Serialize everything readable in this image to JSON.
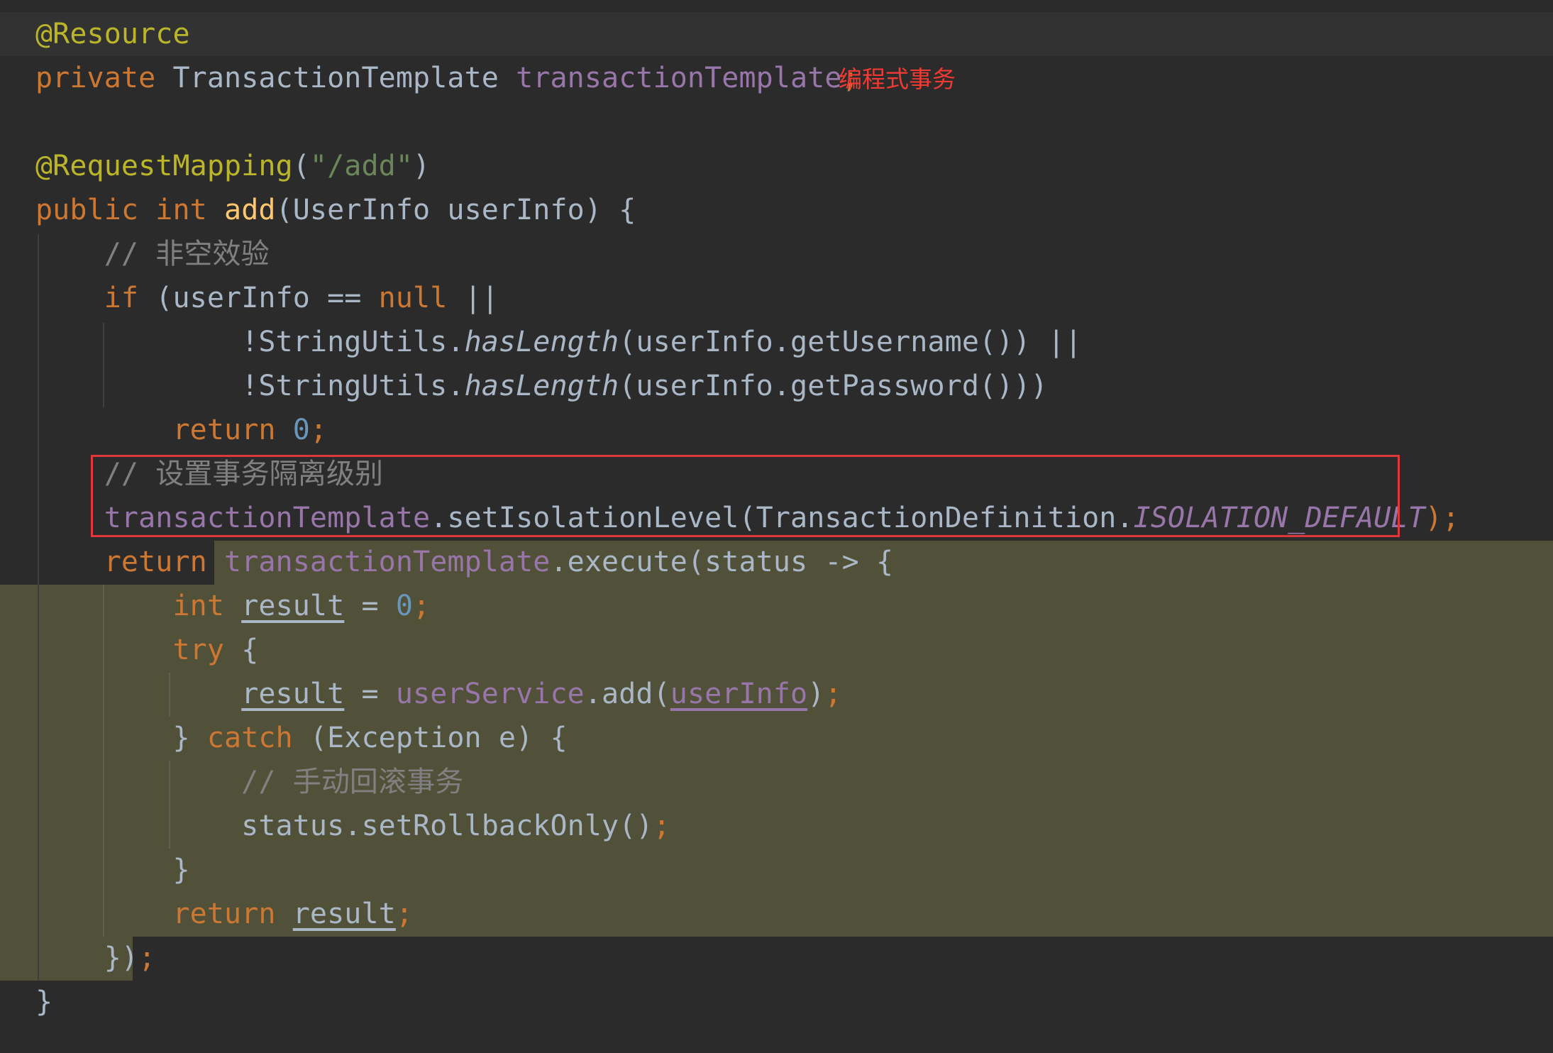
{
  "colors": {
    "background": "#2b2b2b",
    "caret_line": "#323232",
    "lambda_highlight": "#515039",
    "keyword": "#cc7832",
    "annotation": "#bbb529",
    "field": "#9876aa",
    "plain": "#a9b7c6",
    "method_decl": "#ffc66d",
    "string": "#6a8759",
    "number": "#6897bb",
    "comment": "#808080",
    "callout_red": "#ef3b33"
  },
  "annotation_label": "编程式事务",
  "code_lines": [
    {
      "tokens": [
        {
          "text": "@Resource",
          "c": "ann"
        }
      ]
    },
    {
      "tokens": [
        {
          "text": "private ",
          "c": "kw"
        },
        {
          "text": "TransactionTemplate ",
          "c": "txt"
        },
        {
          "text": "transactionTemplate",
          "c": "fld"
        },
        {
          "text": ";",
          "c": "kw"
        }
      ]
    },
    {
      "tokens": []
    },
    {
      "tokens": [
        {
          "text": "@RequestMapping",
          "c": "ann"
        },
        {
          "text": "(",
          "c": "txt"
        },
        {
          "text": "\"/add\"",
          "c": "str"
        },
        {
          "text": ")",
          "c": "txt"
        }
      ]
    },
    {
      "tokens": [
        {
          "text": "public ",
          "c": "kw"
        },
        {
          "text": "int ",
          "c": "kw"
        },
        {
          "text": "add",
          "c": "fn"
        },
        {
          "text": "(UserInfo userInfo) {",
          "c": "txt"
        }
      ]
    },
    {
      "tokens": [
        {
          "text": "    // 非空效验",
          "c": "cmt"
        }
      ]
    },
    {
      "tokens": [
        {
          "text": "    ",
          "c": "txt"
        },
        {
          "text": "if ",
          "c": "kw"
        },
        {
          "text": "(userInfo == ",
          "c": "txt"
        },
        {
          "text": "null ",
          "c": "kw"
        },
        {
          "text": "||",
          "c": "txt"
        }
      ]
    },
    {
      "tokens": [
        {
          "text": "            !StringUtils.",
          "c": "txt"
        },
        {
          "text": "hasLength",
          "c": "txt",
          "it": true
        },
        {
          "text": "(userInfo.getUsername()) ||",
          "c": "txt"
        }
      ]
    },
    {
      "tokens": [
        {
          "text": "            !StringUtils.",
          "c": "txt"
        },
        {
          "text": "hasLength",
          "c": "txt",
          "it": true
        },
        {
          "text": "(userInfo.getPassword()))",
          "c": "txt"
        }
      ]
    },
    {
      "tokens": [
        {
          "text": "        ",
          "c": "txt"
        },
        {
          "text": "return ",
          "c": "kw"
        },
        {
          "text": "0",
          "c": "num"
        },
        {
          "text": ";",
          "c": "kw"
        }
      ]
    },
    {
      "tokens": [
        {
          "text": "    // 设置事务隔离级别",
          "c": "cmt"
        }
      ]
    },
    {
      "tokens": [
        {
          "text": "    ",
          "c": "txt"
        },
        {
          "text": "transactionTemplate",
          "c": "fld"
        },
        {
          "text": ".setIsolationLevel(TransactionDefinition.",
          "c": "txt"
        },
        {
          "text": "ISOLATION_DEFAULT",
          "c": "fld",
          "it": true
        },
        {
          "text": ");",
          "c": "kw"
        }
      ]
    },
    {
      "tokens": [
        {
          "text": "    ",
          "c": "txt"
        },
        {
          "text": "return ",
          "c": "kw"
        },
        {
          "text": "transactionTemplate",
          "c": "fld"
        },
        {
          "text": ".execute(status -> {",
          "c": "txt"
        }
      ]
    },
    {
      "tokens": [
        {
          "text": "        ",
          "c": "txt"
        },
        {
          "text": "int ",
          "c": "kw"
        },
        {
          "text": "result",
          "c": "txt",
          "ul": true
        },
        {
          "text": " = ",
          "c": "txt"
        },
        {
          "text": "0",
          "c": "num"
        },
        {
          "text": ";",
          "c": "kw"
        }
      ]
    },
    {
      "tokens": [
        {
          "text": "        ",
          "c": "txt"
        },
        {
          "text": "try ",
          "c": "kw"
        },
        {
          "text": "{",
          "c": "txt"
        }
      ]
    },
    {
      "tokens": [
        {
          "text": "            ",
          "c": "txt"
        },
        {
          "text": "result",
          "c": "txt",
          "ul": true
        },
        {
          "text": " = ",
          "c": "txt"
        },
        {
          "text": "userService",
          "c": "fld"
        },
        {
          "text": ".add(",
          "c": "txt"
        },
        {
          "text": "userInfo",
          "c": "fld",
          "ulf": true
        },
        {
          "text": ")",
          "c": "txt"
        },
        {
          "text": ";",
          "c": "kw"
        }
      ]
    },
    {
      "tokens": [
        {
          "text": "        } ",
          "c": "txt"
        },
        {
          "text": "catch ",
          "c": "kw"
        },
        {
          "text": "(Exception e) {",
          "c": "txt"
        }
      ]
    },
    {
      "tokens": [
        {
          "text": "            // 手动回滚事务",
          "c": "cmt"
        }
      ]
    },
    {
      "tokens": [
        {
          "text": "            status.setRollbackOnly()",
          "c": "txt"
        },
        {
          "text": ";",
          "c": "kw"
        }
      ]
    },
    {
      "tokens": [
        {
          "text": "        }",
          "c": "txt"
        }
      ]
    },
    {
      "tokens": [
        {
          "text": "        ",
          "c": "txt"
        },
        {
          "text": "return ",
          "c": "kw"
        },
        {
          "text": "result",
          "c": "txt",
          "ul": true
        },
        {
          "text": ";",
          "c": "kw"
        }
      ]
    },
    {
      "tokens": [
        {
          "text": "    })",
          "c": "txt"
        },
        {
          "text": ";",
          "c": "kw"
        }
      ]
    },
    {
      "tokens": [
        {
          "text": "}",
          "c": "txt"
        }
      ]
    }
  ]
}
